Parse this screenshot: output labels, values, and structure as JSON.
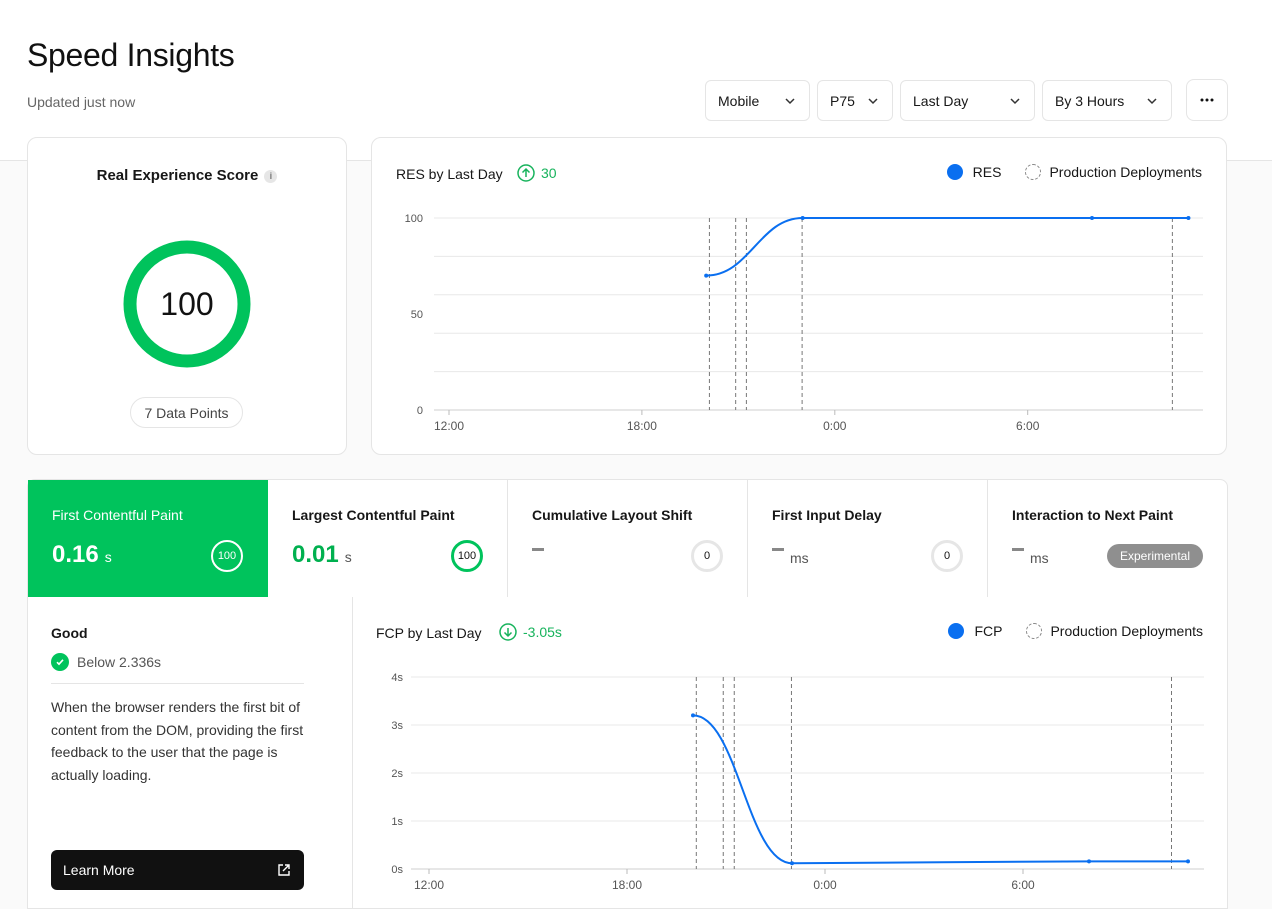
{
  "header": {
    "title": "Speed Insights",
    "subtitle": "Updated just now",
    "filters": {
      "device": "Mobile",
      "percentile": "P75",
      "range": "Last Day",
      "granularity": "By 3 Hours"
    },
    "more_icon": "ellipsis-icon"
  },
  "score_card": {
    "title": "Real Experience Score",
    "info_icon": "i",
    "score": "100",
    "data_points": "7 Data Points",
    "ring_color": "#00c35c"
  },
  "res_chart": {
    "title": "RES by Last Day",
    "delta": "30",
    "legend_series": "RES",
    "legend_deployments": "Production Deployments"
  },
  "metrics": [
    {
      "label": "First Contentful Paint",
      "value": "0.16",
      "unit": "s",
      "score": "100",
      "active": true
    },
    {
      "label": "Largest Contentful Paint",
      "value": "0.01",
      "unit": "s",
      "score": "100",
      "active": false
    },
    {
      "label": "Cumulative Layout Shift",
      "value": "",
      "unit": "",
      "score": "0",
      "active": false
    },
    {
      "label": "First Input Delay",
      "value": "",
      "unit": "ms",
      "score": "0",
      "active": false
    },
    {
      "label": "Interaction to Next Paint",
      "value": "",
      "unit": "ms",
      "badge": "Experimental",
      "active": false
    }
  ],
  "detail": {
    "status": "Good",
    "threshold": "Below 2.336s",
    "description": "When the browser renders the first bit of content from the DOM, providing the first feedback to the user that the page is actually loading.",
    "learn_more": "Learn More"
  },
  "fcp_chart": {
    "title": "FCP by Last Day",
    "delta": "-3.05s",
    "legend_series": "FCP",
    "legend_deployments": "Production Deployments"
  },
  "colors": {
    "accent_green": "#00c35c",
    "line_blue": "#0a6ff0"
  },
  "chart_data": [
    {
      "type": "line",
      "title": "RES by Last Day",
      "x_ticks": [
        "12:00",
        "18:00",
        "0:00",
        "6:00"
      ],
      "y_ticks": [
        "0",
        "50",
        "100"
      ],
      "ylim": [
        0,
        100
      ],
      "series": [
        {
          "name": "RES",
          "x": [
            "20:00",
            "23:00",
            "8:00",
            "11:00"
          ],
          "values": [
            70,
            100,
            100,
            100
          ]
        }
      ],
      "deployments": [
        "20:06",
        "20:55",
        "21:15",
        "22:59",
        "10:30"
      ],
      "grid": true,
      "legend": "top-right"
    },
    {
      "type": "line",
      "title": "FCP by Last Day",
      "x_ticks": [
        "12:00",
        "18:00",
        "0:00",
        "6:00"
      ],
      "y_ticks": [
        "0s",
        "1s",
        "2s",
        "3s",
        "4s"
      ],
      "ylim": [
        0,
        4
      ],
      "series": [
        {
          "name": "FCP",
          "x": [
            "20:00",
            "23:00",
            "8:00",
            "11:00"
          ],
          "values": [
            3.2,
            0.12,
            0.16,
            0.16
          ]
        }
      ],
      "deployments": [
        "20:06",
        "20:55",
        "21:15",
        "22:59",
        "10:30"
      ],
      "grid": true,
      "legend": "top-right"
    }
  ]
}
